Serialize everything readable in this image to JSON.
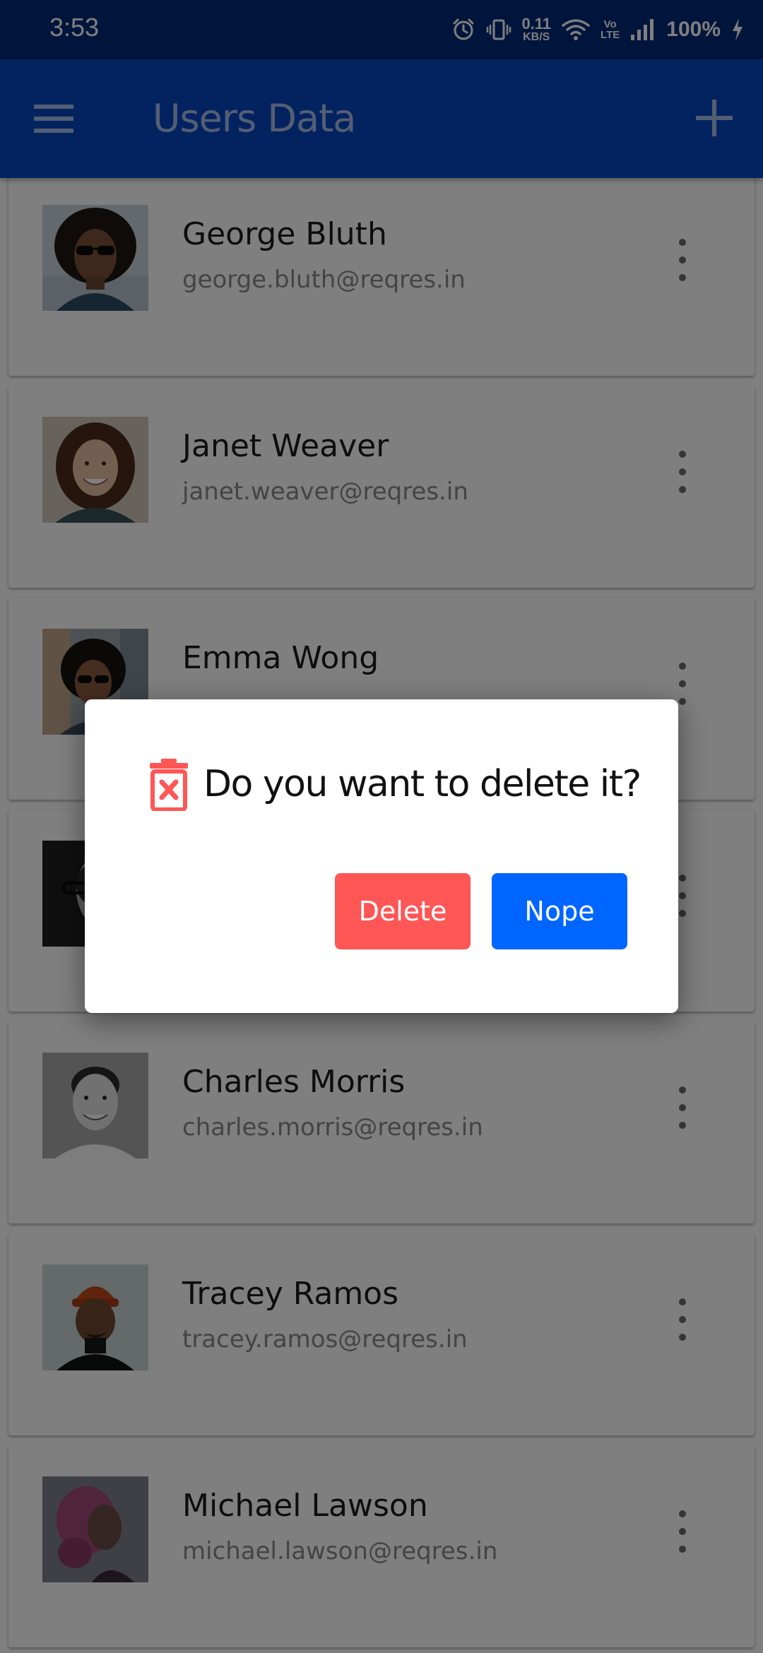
{
  "status_bar": {
    "time": "3:53",
    "net_speed_value": "0.11",
    "net_speed_unit": "KB/S",
    "volte_top": "Vo",
    "volte_bottom": "LTE",
    "battery": "100%",
    "icons": [
      "alarm-icon",
      "vibrate-icon",
      "wifi-icon",
      "volte-icon",
      "signal-icon",
      "charging-icon"
    ]
  },
  "app_bar": {
    "title": "Users Data",
    "menu_icon": "hamburger-icon",
    "add_icon": "plus-icon",
    "color": "#0747c0"
  },
  "users": [
    {
      "name": "George Bluth",
      "email": "george.bluth@reqres.in"
    },
    {
      "name": "Janet Weaver",
      "email": "janet.weaver@reqres.in"
    },
    {
      "name": "Emma Wong",
      "email": ""
    },
    {
      "name": "",
      "email": ""
    },
    {
      "name": "Charles Morris",
      "email": "charles.morris@reqres.in"
    },
    {
      "name": "Tracey Ramos",
      "email": "tracey.ramos@reqres.in"
    },
    {
      "name": "Michael Lawson",
      "email": "michael.lawson@reqres.in"
    }
  ],
  "dialog": {
    "title": "Do you want to delete it?",
    "icon": "trash-x-icon",
    "delete_label": "Delete",
    "nope_label": "Nope",
    "delete_color": "#ff5656",
    "nope_color": "#0066ff"
  }
}
